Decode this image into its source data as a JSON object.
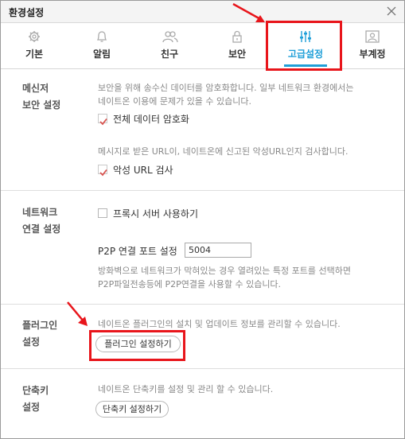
{
  "window": {
    "title": "환경설정"
  },
  "tabs": [
    {
      "label": "기본",
      "icon": "gear-icon"
    },
    {
      "label": "알림",
      "icon": "bell-icon"
    },
    {
      "label": "친구",
      "icon": "friends-icon"
    },
    {
      "label": "보안",
      "icon": "lock-icon"
    },
    {
      "label": "고급설정",
      "icon": "sliders-icon",
      "active": true
    },
    {
      "label": "부계정",
      "icon": "sub-account-icon"
    }
  ],
  "messenger_security": {
    "heading_line1": "메신저",
    "heading_line2": "보안 설정",
    "desc1_line1": "보안을 위해 송수신 데이터를 암호화합니다. 일부 네트워크 환경에서는",
    "desc1_line2": "네이트온 이용에 문제가 있을 수 있습니다.",
    "encrypt_label": "전체 데이터 암호화",
    "encrypt_checked": true,
    "desc2": "메시지로 받은 URL이, 네이트온에 신고된 악성URL인지 검사합니다.",
    "url_check_label": "악성 URL 검사",
    "url_check_checked": true
  },
  "network": {
    "heading_line1": "네트워크",
    "heading_line2": "연결 설정",
    "proxy_label": "프록시 서버 사용하기",
    "proxy_checked": false,
    "port_label": "P2P 연결 포트 설정",
    "port_value": "5004",
    "desc_line1": "방화벽으로 네트워크가 막혀있는 경우 열려있는 특정 포트를 선택하면",
    "desc_line2": "P2P파일전송등에 P2P연결을 사용할 수 있습니다."
  },
  "plugin": {
    "heading_line1": "플러그인",
    "heading_line2": "설정",
    "desc": "네이트온 플러그인의 설치 및 업데이트 정보를 관리할 수 있습니다.",
    "button_label": "플러그인 설정하기"
  },
  "shortcut": {
    "heading_line1": "단축키",
    "heading_line2": "설정",
    "desc": "네이트온 단축키를 설정 및 관리 할 수 있습니다.",
    "button_label": "단축키 설정하기"
  },
  "colors": {
    "accent": "#1f9fd8",
    "highlight": "#e8151b",
    "check": "#d9534f"
  }
}
